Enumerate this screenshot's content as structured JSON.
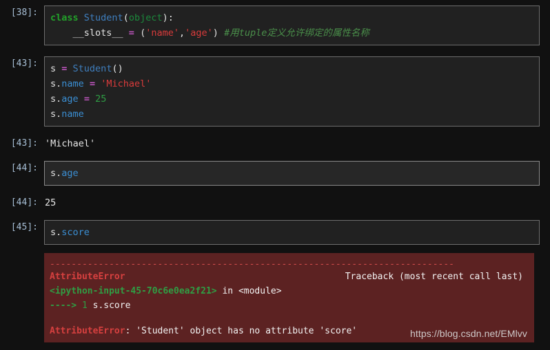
{
  "notebook": {
    "theme": {
      "page_background": "#111111",
      "cell_background": "#212121",
      "cell_background_focused": "#272727",
      "cell_border": "#6e6e6e",
      "error_background": "#5c2222",
      "prompt_color": "#a7bfd6",
      "keyword_color": "#22a12a",
      "class_color": "#3f7fbf",
      "builtin_color": "#1c8a3c",
      "operator_color": "#c457c4",
      "string_color": "#d93b3b",
      "number_color": "#2f9e44",
      "attribute_color": "#3b8fd4",
      "comment_color": "#4a8f4a",
      "error_name_color": "#d6403f"
    },
    "cells": [
      {
        "prompt": "[38]:",
        "type": "code",
        "focused": false,
        "lines": [
          [
            {
              "t": "class",
              "c": "kw"
            },
            {
              "t": " ",
              "c": "name"
            },
            {
              "t": "Student",
              "c": "cls"
            },
            {
              "t": "(",
              "c": "punc"
            },
            {
              "t": "object",
              "c": "builtin"
            },
            {
              "t": "):",
              "c": "punc"
            }
          ],
          [
            {
              "t": "    __slots__ ",
              "c": "name"
            },
            {
              "t": "=",
              "c": "op"
            },
            {
              "t": " ",
              "c": "name"
            },
            {
              "t": "(",
              "c": "punc"
            },
            {
              "t": "'name'",
              "c": "str"
            },
            {
              "t": ",",
              "c": "punc"
            },
            {
              "t": "'age'",
              "c": "str"
            },
            {
              "t": ")",
              "c": "punc"
            },
            {
              "t": " ",
              "c": "name"
            },
            {
              "t": "#用tuple定义允许绑定的属性名称",
              "c": "comment"
            }
          ]
        ]
      },
      {
        "prompt": "[43]:",
        "type": "code",
        "focused": false,
        "lines": [
          [
            {
              "t": "s ",
              "c": "name"
            },
            {
              "t": "=",
              "c": "op"
            },
            {
              "t": " ",
              "c": "name"
            },
            {
              "t": "Student",
              "c": "cls"
            },
            {
              "t": "()",
              "c": "punc"
            }
          ],
          [
            {
              "t": "s",
              "c": "name"
            },
            {
              "t": ".",
              "c": "punc"
            },
            {
              "t": "name",
              "c": "attr"
            },
            {
              "t": " ",
              "c": "name"
            },
            {
              "t": "=",
              "c": "op"
            },
            {
              "t": " ",
              "c": "name"
            },
            {
              "t": "'Michael'",
              "c": "str"
            }
          ],
          [
            {
              "t": "s",
              "c": "name"
            },
            {
              "t": ".",
              "c": "punc"
            },
            {
              "t": "age",
              "c": "attr"
            },
            {
              "t": " ",
              "c": "name"
            },
            {
              "t": "=",
              "c": "op"
            },
            {
              "t": " ",
              "c": "name"
            },
            {
              "t": "25",
              "c": "num"
            }
          ],
          [
            {
              "t": "s",
              "c": "name"
            },
            {
              "t": ".",
              "c": "punc"
            },
            {
              "t": "name",
              "c": "attr"
            }
          ]
        ]
      },
      {
        "prompt": "[43]:",
        "type": "output",
        "text": "'Michael'"
      },
      {
        "prompt": "[44]:",
        "type": "code",
        "focused": true,
        "lines": [
          [
            {
              "t": "s",
              "c": "name"
            },
            {
              "t": ".",
              "c": "punc"
            },
            {
              "t": "age",
              "c": "attr"
            }
          ]
        ]
      },
      {
        "prompt": "[44]:",
        "type": "output",
        "text": "25"
      },
      {
        "prompt": "[45]:",
        "type": "code",
        "focused": false,
        "lines": [
          [
            {
              "t": "s",
              "c": "name"
            },
            {
              "t": ".",
              "c": "punc"
            },
            {
              "t": "score",
              "c": "attr"
            }
          ]
        ]
      }
    ]
  },
  "traceback": {
    "rule": "---------------------------------------------------------------------------",
    "header_left": "AttributeError",
    "header_right": "Traceback (most recent call last)",
    "frame_file": "<ipython-input-45-70c6e0ea2f21>",
    "frame_in": " in ",
    "frame_scope": "<module>",
    "arrow": "----> ",
    "lineno": "1",
    "source": " s.score",
    "error_name": "AttributeError",
    "error_message": ": 'Student' object has no attribute 'score'"
  },
  "watermark": {
    "text": "https://blog.csdn.net/EMlvv"
  }
}
